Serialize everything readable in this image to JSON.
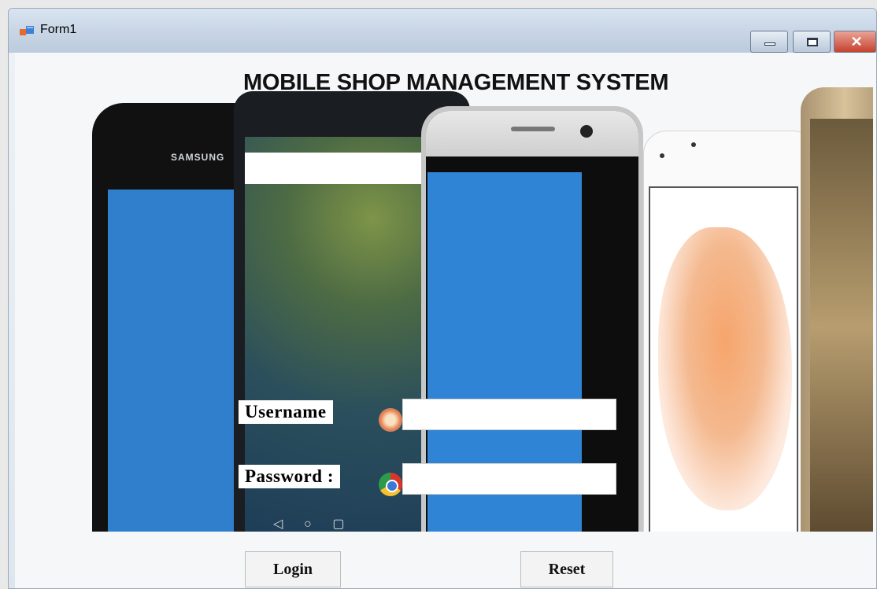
{
  "window": {
    "title": "Form1"
  },
  "heading": "MOBILE SHOP MANAGEMENT SYSTEM",
  "banner": {
    "brand": "SAMSUNG"
  },
  "form": {
    "username_label": "Username",
    "password_label": "Password",
    "username_value": "",
    "password_value": ""
  },
  "buttons": {
    "login": "Login",
    "reset": "Reset"
  },
  "icons": {
    "app": "form-app-icon",
    "minimize": "minimize-icon",
    "maximize": "maximize-icon",
    "close": "close-icon"
  },
  "colors": {
    "close_button": "#c6422f",
    "titlebar": "#c8d6e6",
    "heading": "#111111"
  }
}
